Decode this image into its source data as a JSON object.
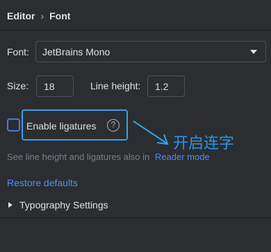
{
  "breadcrumb": {
    "parent": "Editor",
    "separator": "›",
    "current": "Font"
  },
  "font": {
    "label": "Font:",
    "selected": "JetBrains Mono"
  },
  "size": {
    "label": "Size:",
    "value": "18"
  },
  "line_height": {
    "label": "Line height:",
    "value": "1.2"
  },
  "ligatures": {
    "label": "Enable ligatures",
    "checked": false,
    "help_glyph": "?"
  },
  "annotation": {
    "text": "开启连字"
  },
  "hint": {
    "text": "See line height and ligatures also in",
    "link": "Reader mode"
  },
  "restore": {
    "label": "Restore defaults"
  },
  "typography": {
    "label": "Typography Settings",
    "expanded": false
  },
  "colors": {
    "accent": "#548af7",
    "annotation": "#2a95e8",
    "background": "#2b2d30"
  }
}
